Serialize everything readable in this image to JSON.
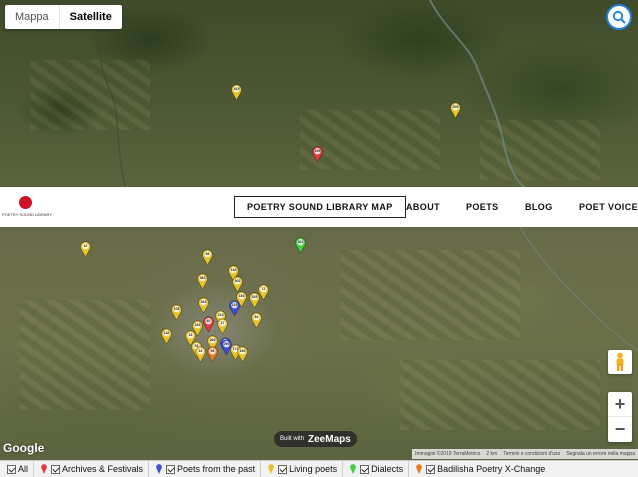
{
  "map": {
    "type_control": {
      "map_label": "Mappa",
      "satellite_label": "Satellite",
      "selected": "Satellite"
    },
    "zoom": {
      "in_label": "+",
      "out_label": "−"
    },
    "google_logo": "Google",
    "built_with": {
      "prefix": "Built with",
      "brand": "ZeeMaps"
    },
    "attribution": {
      "imagery": "Immagini ©2019 TerraMetrics",
      "scale": "2 km",
      "terms": "Termini e condizioni d'uso",
      "report": "Segnala un errore nella mappa"
    }
  },
  "site": {
    "logo_text": "POETRY SOUND LIBRARY",
    "nav": [
      {
        "label": "POETRY SOUND LIBRARY MAP",
        "active": true
      },
      {
        "label": "ABOUT",
        "active": false
      },
      {
        "label": "POETS",
        "active": false
      },
      {
        "label": "BLOG",
        "active": false
      },
      {
        "label": "POET VOICE P",
        "active": false
      }
    ]
  },
  "legend": {
    "items": [
      {
        "label": "All",
        "icon": "none",
        "color": ""
      },
      {
        "label": "Archives & Festivals",
        "icon": "pin-icon",
        "color": "#e23b3b"
      },
      {
        "label": "Poets from the past",
        "icon": "pin-icon",
        "color": "#3b4fd8"
      },
      {
        "label": "Living poets",
        "icon": "pin-icon",
        "color": "#e8c22a"
      },
      {
        "label": "Dialects",
        "icon": "pin-icon",
        "color": "#3fcf3f"
      },
      {
        "label": "Badilisha Poetry X-Change",
        "icon": "pin-icon",
        "color": "#e87a2a"
      }
    ]
  },
  "pins": [
    {
      "label": "419",
      "color": "#e8c22a"
    },
    {
      "label": "209",
      "color": "#e8c22a"
    },
    {
      "label": "165",
      "color": "#e23b3b"
    },
    {
      "label": "42",
      "color": "#e8c22a"
    },
    {
      "label": "301",
      "color": "#3fcf3f"
    },
    {
      "label": "85",
      "color": "#e8c22a"
    },
    {
      "label": "108",
      "color": "#e8c22a"
    },
    {
      "label": "363",
      "color": "#e8c22a"
    },
    {
      "label": "154",
      "color": "#e8c22a"
    },
    {
      "label": "302",
      "color": "#e8c22a"
    },
    {
      "label": "72",
      "color": "#e8c22a"
    },
    {
      "label": "329",
      "color": "#e8c22a"
    },
    {
      "label": "154",
      "color": "#e8c22a"
    },
    {
      "label": "123",
      "color": "#3b4fd8"
    },
    {
      "label": "304",
      "color": "#e8c22a"
    },
    {
      "label": "118",
      "color": "#e8c22a"
    },
    {
      "label": "214",
      "color": "#e8c22a"
    },
    {
      "label": "163",
      "color": "#e8c22a"
    },
    {
      "label": "60",
      "color": "#e23b3b"
    },
    {
      "label": "27",
      "color": "#e8c22a"
    },
    {
      "label": "131",
      "color": "#3b4fd8"
    },
    {
      "label": "33",
      "color": "#e8c22a"
    },
    {
      "label": "264",
      "color": "#e8c22a"
    },
    {
      "label": "84",
      "color": "#e8c22a"
    },
    {
      "label": "53",
      "color": "#e8c22a"
    },
    {
      "label": "290",
      "color": "#3b4fd8"
    },
    {
      "label": "171",
      "color": "#e8c22a"
    },
    {
      "label": "180",
      "color": "#e8c22a"
    },
    {
      "label": "96",
      "color": "#e87a2a"
    },
    {
      "label": "32",
      "color": "#e8c22a"
    }
  ]
}
